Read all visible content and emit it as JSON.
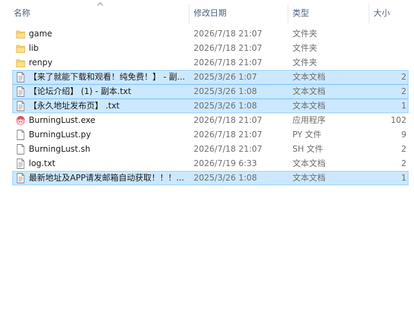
{
  "columns": {
    "name": "名称",
    "date": "修改日期",
    "type": "类型",
    "size": "大小"
  },
  "colors": {
    "selection_bg": "#cce8ff",
    "selection_border": "#99d1ff",
    "folder": "#f8d775",
    "header_text": "#4c607a"
  },
  "files": [
    {
      "icon": "folder-icon",
      "name": "game",
      "date": "2026/7/18 21:07",
      "type": "文件夹",
      "size": "",
      "selected": false
    },
    {
      "icon": "folder-icon",
      "name": "lib",
      "date": "2026/7/18 21:07",
      "type": "文件夹",
      "size": "",
      "selected": false
    },
    {
      "icon": "folder-icon",
      "name": "renpy",
      "date": "2026/7/18 21:07",
      "type": "文件夹",
      "size": "",
      "selected": false
    },
    {
      "icon": "text-file-icon",
      "name": "【来了就能下载和观看！纯免费！】 - 副...",
      "date": "2025/3/26 1:07",
      "type": "文本文档",
      "size": "2",
      "selected": true
    },
    {
      "icon": "text-file-icon",
      "name": "【论坛介绍】 (1) - 副本.txt",
      "date": "2025/3/26 1:08",
      "type": "文本文档",
      "size": "2",
      "selected": true
    },
    {
      "icon": "text-file-icon",
      "name": "【永久地址发布页】 .txt",
      "date": "2025/3/26 1:08",
      "type": "文本文档",
      "size": "1",
      "selected": true
    },
    {
      "icon": "app-exe-icon",
      "name": "BurningLust.exe",
      "date": "2026/7/18 21:07",
      "type": "应用程序",
      "size": "102",
      "selected": false
    },
    {
      "icon": "blank-file-icon",
      "name": "BurningLust.py",
      "date": "2026/7/18 21:07",
      "type": "PY 文件",
      "size": "9",
      "selected": false
    },
    {
      "icon": "blank-file-icon",
      "name": "BurningLust.sh",
      "date": "2026/7/18 21:07",
      "type": "SH 文件",
      "size": "2",
      "selected": false
    },
    {
      "icon": "text-file-icon",
      "name": "log.txt",
      "date": "2026/7/19 6:33",
      "type": "文本文档",
      "size": "2",
      "selected": false
    },
    {
      "icon": "text-file-icon",
      "name": "最新地址及APP请发邮箱自动获取！！！...",
      "date": "2025/3/26 1:08",
      "type": "文本文档",
      "size": "1",
      "selected": true
    }
  ]
}
